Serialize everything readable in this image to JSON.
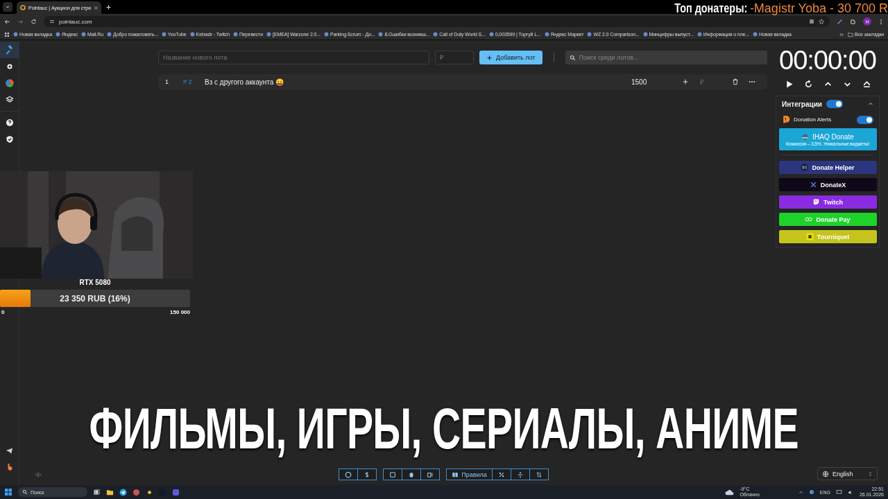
{
  "overlay": {
    "top_label": "Топ донатеры:",
    "top_value": "-Magistr Yoba - 30 700 R",
    "caption": "ФИЛЬМЫ, ИГРЫ, СЕРИАЛЫ, АНИМЕ"
  },
  "browser": {
    "tab_title": "Pointauc | Аукцион для стри",
    "address": "pointauc.com",
    "profile": "H",
    "bookmarks": [
      "Новая вкладка",
      "Яндекс",
      "Mail.Ru",
      "Добро пожаловать...",
      "YouTube",
      "Kebastr - Twitch",
      "Перевести",
      "[EMEA] Warzone 2.0...",
      "Parking.Scrum - До...",
      "8.Ошибки возникш...",
      "Call of Duty World S...",
      "0,003599 | Торгуй L...",
      "Яндекс Маркет",
      "WZ 2.0 Comparison...",
      "Минцифры выпуст...",
      "Информация о пле...",
      "Новая вкладка"
    ],
    "all_bookmarks": "Все закладки"
  },
  "sidebar": {
    "items": [
      {
        "selected": true
      },
      {
        "selected": false
      },
      {
        "selected": false
      },
      {
        "selected": false
      }
    ]
  },
  "lot_form": {
    "name_placeholder": "Название нового лота",
    "price_placeholder": "₽",
    "add_button": "Добавить лот",
    "search_placeholder": "Поиск среди лотов..."
  },
  "lots": [
    {
      "number": "1",
      "id": "# 2",
      "name": "Вз с другого аккаунта 😛",
      "amount": "1500",
      "currency": "₽"
    }
  ],
  "timer": "00:00:00",
  "integrations": {
    "title": "Интеграции",
    "on": true,
    "expanded": true,
    "donation_alerts": {
      "label": "Donation Alerts",
      "on": true
    },
    "buttons": [
      {
        "label": "IHAQ Donate",
        "subtitle": "Комиссия – 3,5%. Уникальные виджеты!",
        "color": "#1ba6d6"
      },
      {
        "label": "Donate Helper",
        "color": "#2c3580"
      },
      {
        "label": "DonateX",
        "color": "#0e0818"
      },
      {
        "label": "Twitch",
        "color": "#8a2be2"
      },
      {
        "label": "Donate Pay",
        "color": "#1fd22a"
      },
      {
        "label": "Tourniquet",
        "color": "#c4c41c"
      }
    ]
  },
  "goal": {
    "title": "RTX 5080",
    "progress": "23 350 RUB (16%)",
    "level": 0.16,
    "min": "0",
    "max": "150 000"
  },
  "toolbar": {
    "rules": "Правила",
    "language": "English"
  },
  "taskbar": {
    "search": "Поиск",
    "temperature": "-9°C",
    "weather": "Облачно",
    "lang": "ENG",
    "time": "22:51",
    "date": "26.01.2026"
  }
}
